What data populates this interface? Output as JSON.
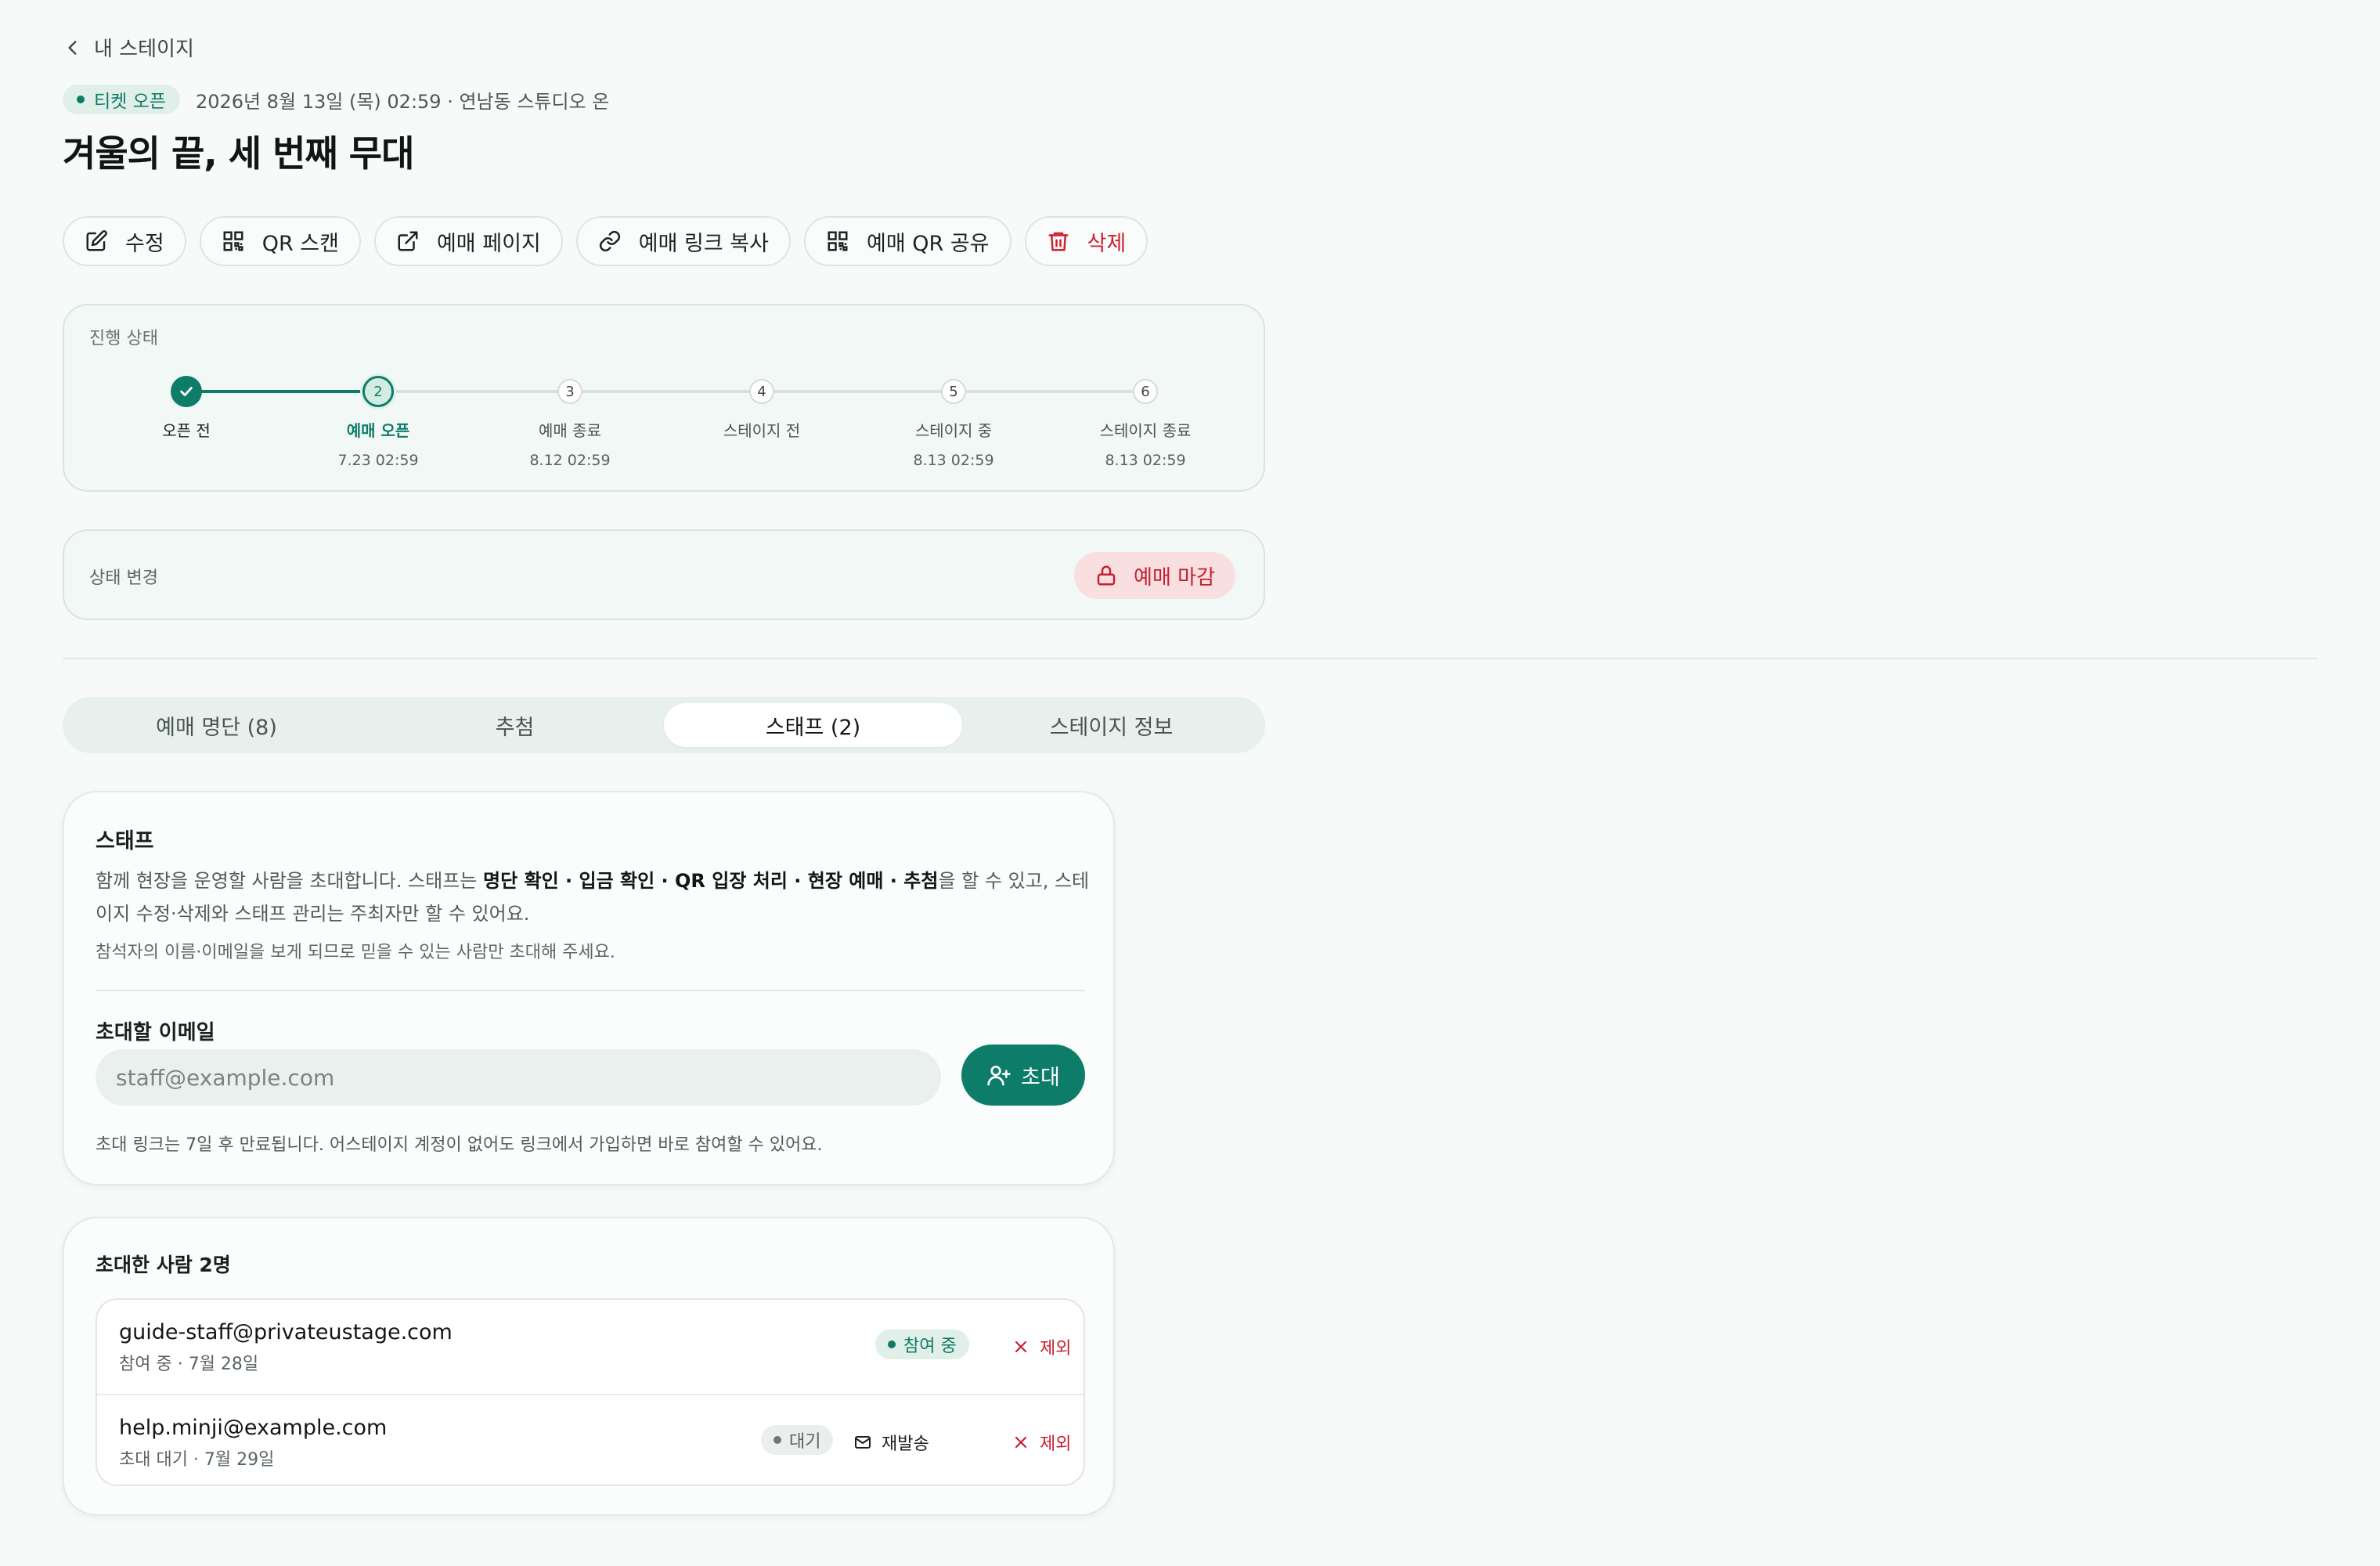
{
  "nav": {
    "back_label": "내 스테이지"
  },
  "event": {
    "status_badge": "티켓 오픈",
    "datetime_venue": "2026년 8월 13일 (목) 02:59 · 연남동 스튜디오 온",
    "title": "겨울의 끝, 세 번째 무대"
  },
  "actions": {
    "edit": "수정",
    "qr_scan": "QR 스캔",
    "booking_page": "예매 페이지",
    "copy_link": "예매 링크 복사",
    "share_qr": "예매 QR 공유",
    "delete": "삭제"
  },
  "progress": {
    "label": "진행 상태",
    "current_step": 2,
    "steps": [
      {
        "number": "1",
        "name": "오픈 전",
        "date": ""
      },
      {
        "number": "2",
        "name": "예매 오픈",
        "date": "7.23 02:59"
      },
      {
        "number": "3",
        "name": "예매 종료",
        "date": "8.12 02:59"
      },
      {
        "number": "4",
        "name": "스테이지 전",
        "date": ""
      },
      {
        "number": "5",
        "name": "스테이지 중",
        "date": "8.13 02:59"
      },
      {
        "number": "6",
        "name": "스테이지 종료",
        "date": "8.13 02:59"
      }
    ]
  },
  "status_change": {
    "label": "상태 변경",
    "close_button": "예매 마감"
  },
  "tabs": [
    {
      "label": "예매 명단 (8)",
      "active": false
    },
    {
      "label": "추첨",
      "active": false
    },
    {
      "label": "스태프 (2)",
      "active": true
    },
    {
      "label": "스테이지 정보",
      "active": false
    }
  ],
  "staff": {
    "title": "스태프",
    "desc_prefix": "함께 현장을 운영할 사람을 초대합니다. 스태프는 ",
    "desc_bold": "명단 확인 · 입금 확인 · QR 입장 처리 · 현장 예매 · 추첨",
    "desc_suffix": "을 할 수 있고, 스테이지 수정·삭제와 스태프 관리는 주최자만 할 수 있어요.",
    "note": "참석자의 이름·이메일을 보게 되므로 믿을 수 있는 사람만 초대해 주세요.",
    "email_label": "초대할 이메일",
    "email_placeholder": "staff@example.com",
    "email_value": "",
    "invite_button": "초대",
    "expire_note": "초대 링크는 7일 후 만료됩니다. 어스테이지 계정이 없어도 링크에서 가입하면 바로 참여할 수 있어요."
  },
  "invited": {
    "title": "초대한 사람 2명",
    "people": [
      {
        "email": "guide-staff@privateustage.com",
        "sub": "참여 중 · 7월 28일",
        "status": "참여 중",
        "resend": "",
        "remove": "제외"
      },
      {
        "email": "help.minji@example.com",
        "sub": "초대 대기 · 7월 29일",
        "status": "대기",
        "resend": "재발송",
        "remove": "제외"
      }
    ]
  },
  "colors": {
    "accent": "#0d7d69",
    "danger": "#c8202f",
    "background": "#f8faf9"
  }
}
